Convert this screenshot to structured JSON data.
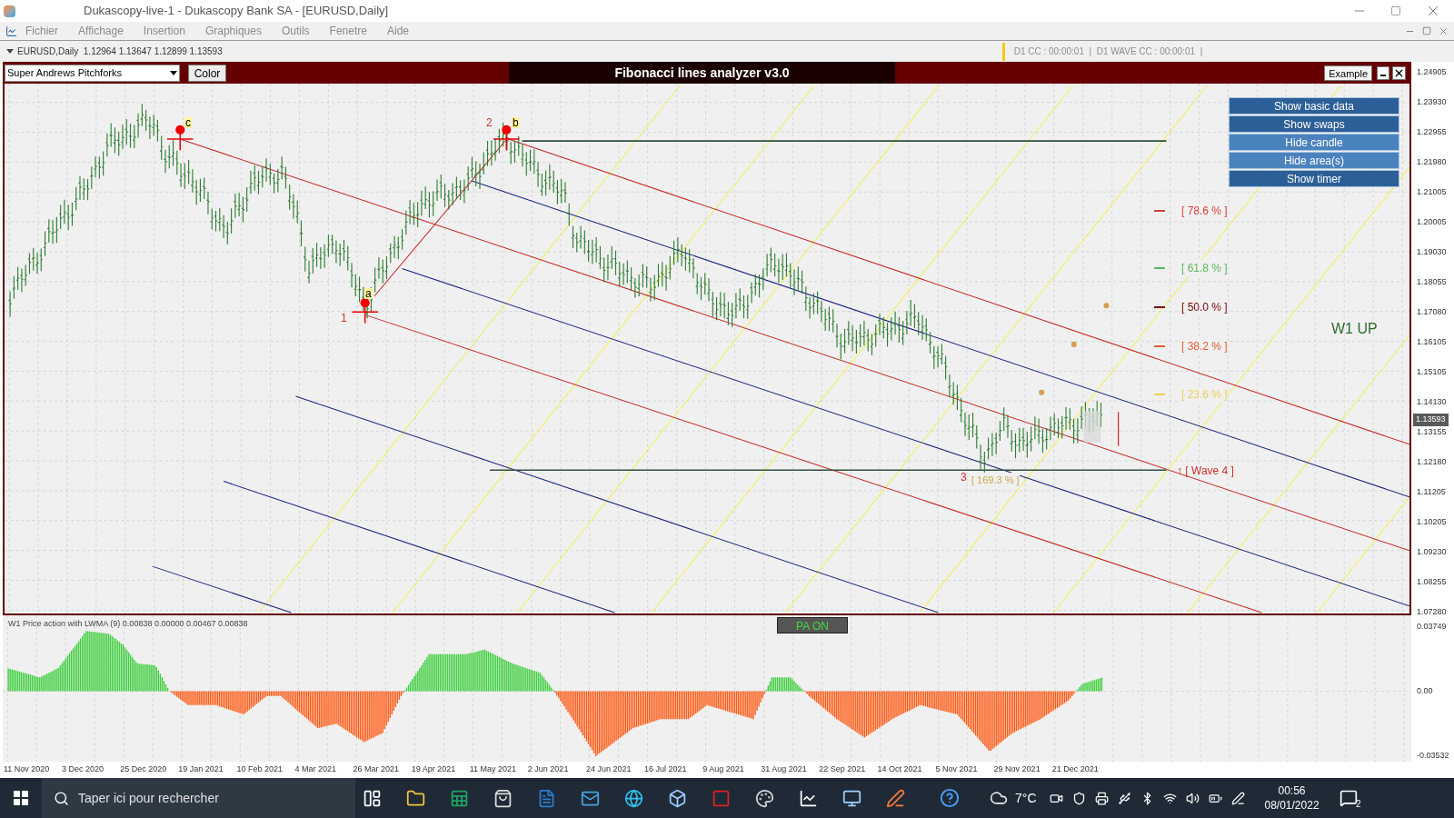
{
  "window": {
    "title": "Dukascopy-live-1 - Dukascopy Bank SA - [EURUSD,Daily]"
  },
  "menu": [
    "Fichier",
    "Affichage",
    "Insertion",
    "Graphiques",
    "Outils",
    "Fenetre",
    "Aide"
  ],
  "chart": {
    "header": "EURUSD,Daily  1.12964 1.13647 1.12899 1.13593",
    "timer": "D1 CC : 00:00:01  |  D1 WAVE CC : 00:00:01  |",
    "price_axis": [
      "1.24905",
      "1.23930",
      "1.22955",
      "1.21980",
      "1.21005",
      "1.20005",
      "1.19030",
      "1.18055",
      "1.17080",
      "1.16105",
      "1.15105",
      "1.14130",
      "1.13155",
      "1.12180",
      "1.11205",
      "1.10205",
      "1.09230",
      "1.08255",
      "1.07280"
    ],
    "current_price": "1.13593",
    "dates": [
      "11 Nov 2020",
      "3 Dec 2020",
      "25 Dec 2020",
      "19 Jan 2021",
      "10 Feb 2021",
      "4 Mar 2021",
      "26 Mar 2021",
      "19 Apr 2021",
      "11 May 2021",
      "2 Jun 2021",
      "24 Jun 2021",
      "16 Jul 2021",
      "9 Aug 2021",
      "31 Aug 2021",
      "22 Sep 2021",
      "14 Oct 2021",
      "5 Nov 2021",
      "29 Nov 2021",
      "21 Dec 2021"
    ]
  },
  "analyzer": {
    "tool": "Super Andrews Pitchforks",
    "color_button": "Color",
    "title": "Fibonacci lines analyzer v3.0",
    "example_button": "Example",
    "buttons": [
      {
        "label": "Show basic data",
        "selected": false
      },
      {
        "label": "Show swaps",
        "selected": false
      },
      {
        "label": "Hide candle",
        "selected": true
      },
      {
        "label": "Hide area(s)",
        "selected": true
      },
      {
        "label": "Show timer",
        "selected": false
      }
    ]
  },
  "fib_levels": [
    {
      "label": "[ 78.6 % ]",
      "color": "#d8403a"
    },
    {
      "label": "[ 61.8 % ]",
      "color": "#5cb85c"
    },
    {
      "label": "[ 50.0 % ]",
      "color": "#7a0a0a"
    },
    {
      "label": "[ 38.2 % ]",
      "color": "#e0603a"
    },
    {
      "label": "[ 23.6 % ]",
      "color": "#e6d25a"
    }
  ],
  "trend_label": "W1 UP",
  "wave_points": [
    "c",
    "1",
    "a",
    "2",
    "b",
    "3"
  ],
  "extension_label": "[ 169.3 % ]",
  "wave_target": "↑ [ Wave 4 ]",
  "indicator": {
    "label": "W1 Price action with LWMA (9) 0.00838 0.00000 0.00467 0.00838",
    "toggle": "PA ON",
    "axis": [
      "0.03749",
      "0.00",
      "-0.03532"
    ]
  },
  "taskbar": {
    "search_placeholder": "Taper ici pour rechercher",
    "temperature": "7°C",
    "time": "00:56",
    "date": "08/01/2022",
    "notifications": "2"
  }
}
